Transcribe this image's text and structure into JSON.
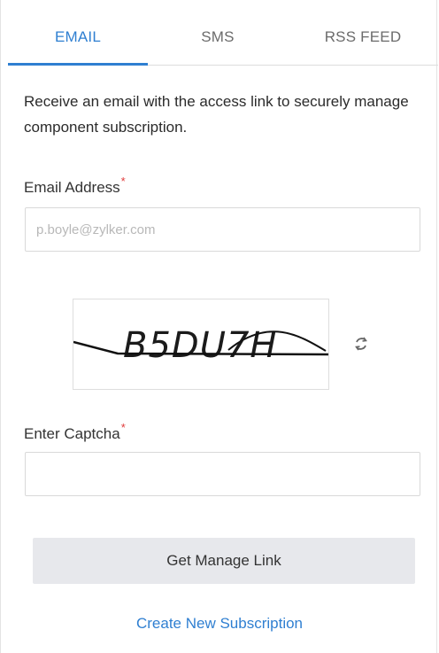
{
  "tabs": [
    {
      "label": "EMAIL",
      "active": true
    },
    {
      "label": "SMS",
      "active": false
    },
    {
      "label": "RSS FEED",
      "active": false
    }
  ],
  "description": "Receive an email with the access link to securely manage component subscription.",
  "email_field": {
    "label": "Email Address",
    "required_marker": "*",
    "placeholder": "p.boyle@zylker.com",
    "value": ""
  },
  "captcha": {
    "image_text": "B5DU7H",
    "refresh_icon": "refresh-icon"
  },
  "captcha_field": {
    "label": "Enter Captcha",
    "required_marker": "*",
    "value": ""
  },
  "actions": {
    "manage_button_label": "Get Manage Link",
    "create_link_label": "Create New Subscription"
  },
  "colors": {
    "accent": "#2f7fd1",
    "required": "#e03b3b",
    "button_bg": "#e7e8ec"
  }
}
